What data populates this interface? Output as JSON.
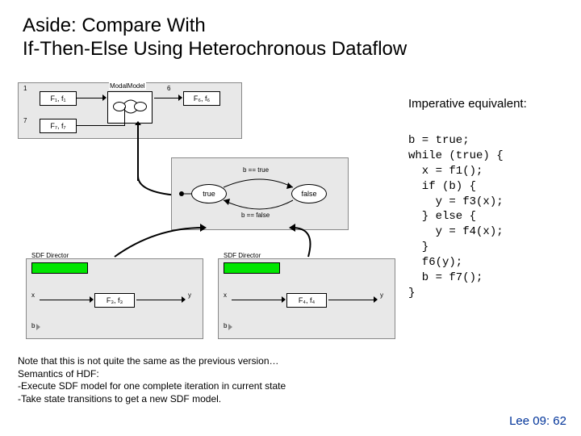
{
  "title_line1": "Aside: Compare With",
  "title_line2": "If-Then-Else Using Heterochronous Dataflow",
  "top_panel": {
    "port1": "1",
    "port6": "6",
    "port7": "7",
    "block1": "F₁, f₁",
    "block6": "F₆, f₆",
    "block7": "F₇, f₇",
    "modal_label": "ModalModel"
  },
  "fsm": {
    "state_true": "true",
    "state_false": "false",
    "guard_true": "b == true",
    "guard_false": "b == false"
  },
  "sdf": {
    "dir_label": "SDF Director",
    "x": "x",
    "y": "y",
    "b": "b",
    "block_left": "F₃, f₃",
    "block_right": "F₄, f₄"
  },
  "imperative_label": "Imperative equivalent:",
  "code": "b = true;\nwhile (true) {\n  x = f1();\n  if (b) {\n    y = f3(x);\n  } else {\n    y = f4(x);\n  }\n  f6(y);\n  b = f7();\n}",
  "note": "Note that this is not quite the same as the previous version…\nSemantics of HDF:\n-Execute SDF model for one complete iteration in current  state\n-Take state transitions to get a new SDF model.",
  "footer": "Lee 09: 62"
}
